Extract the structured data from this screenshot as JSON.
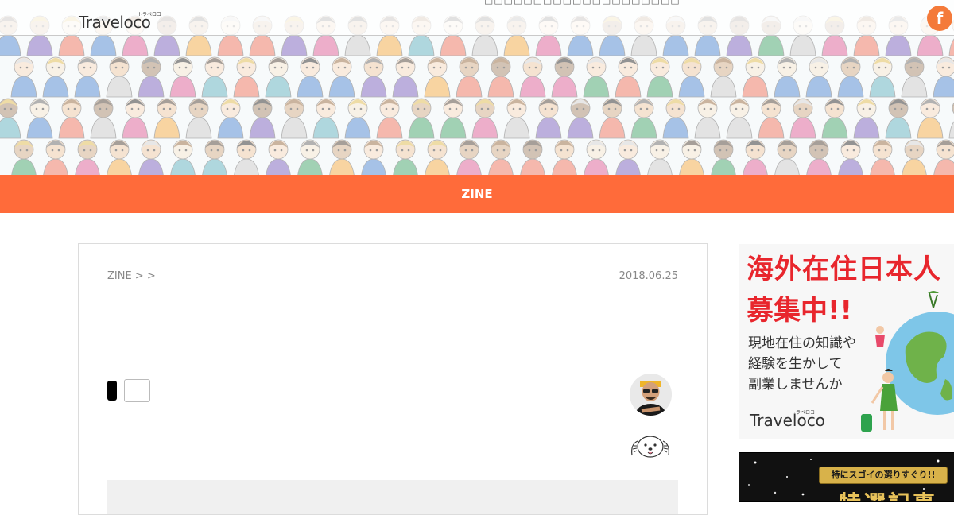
{
  "header": {
    "logo_text": "Traveloco",
    "logo_kana": "トラベロコ",
    "top_nav_text": "□□□□□□□□□□□□□□□□□□□□",
    "social": {
      "facebook_label": "f",
      "facebook_icon": "facebook-icon"
    }
  },
  "category_bar": {
    "label": "ZINE",
    "color": "#ff6b3a"
  },
  "article": {
    "breadcrumb": "ZINE >  >",
    "date": "2018.06.25"
  },
  "sidebar": {
    "ad1": {
      "headline_1": "海外在住日本人",
      "headline_2": "募集中!!",
      "body": "現地在住の知識や\n経験を生かして\n副業しませんか",
      "logo_text": "Traveloco",
      "logo_kana": "トラベロコ"
    },
    "ad2": {
      "ribbon": "特にスゴイの選りすぐり!!",
      "title": "特選記事"
    }
  }
}
